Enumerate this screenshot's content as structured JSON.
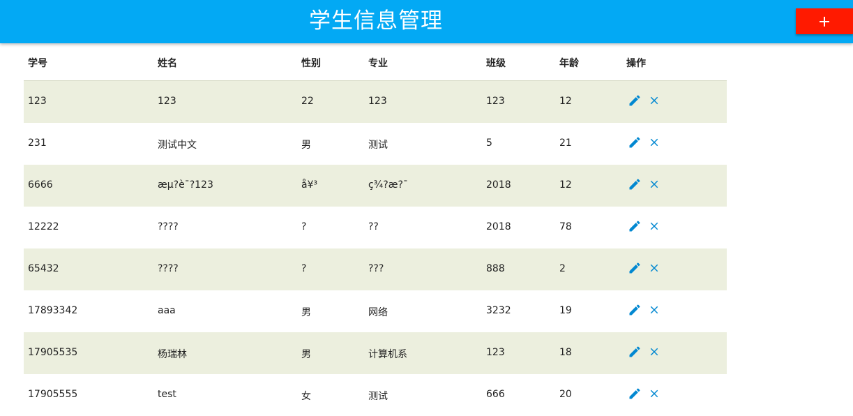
{
  "header": {
    "title": "学生信息管理",
    "add_icon": "plus-icon",
    "background_color": "#03a9f4",
    "add_button_color": "#ff1a00"
  },
  "table": {
    "columns": [
      "学号",
      "姓名",
      "性别",
      "专业",
      "班级",
      "年龄",
      "操作"
    ],
    "row_stripe_color": "#ecefde",
    "action_icon_color": "#0288d1",
    "action_icons": [
      "pencil-icon",
      "close-icon"
    ],
    "rows": [
      [
        "123",
        "123",
        "22",
        "123",
        "123",
        "12"
      ],
      [
        "231",
        "测试中文",
        "男",
        "测试",
        "5",
        "21"
      ],
      [
        "6666",
        "æµ?è¯?123",
        "å¥³",
        "ç¾?æ?¯",
        "2018",
        "12"
      ],
      [
        "12222",
        "????",
        "?",
        "??",
        "2018",
        "78"
      ],
      [
        "65432",
        "????",
        "?",
        "???",
        "888",
        "2"
      ],
      [
        "17893342",
        "aaa",
        "男",
        "网络",
        "3232",
        "19"
      ],
      [
        "17905535",
        "杨瑞林",
        "男",
        "计算机系",
        "123",
        "18"
      ],
      [
        "17905555",
        "test",
        "女",
        "测试",
        "666",
        "20"
      ]
    ]
  }
}
